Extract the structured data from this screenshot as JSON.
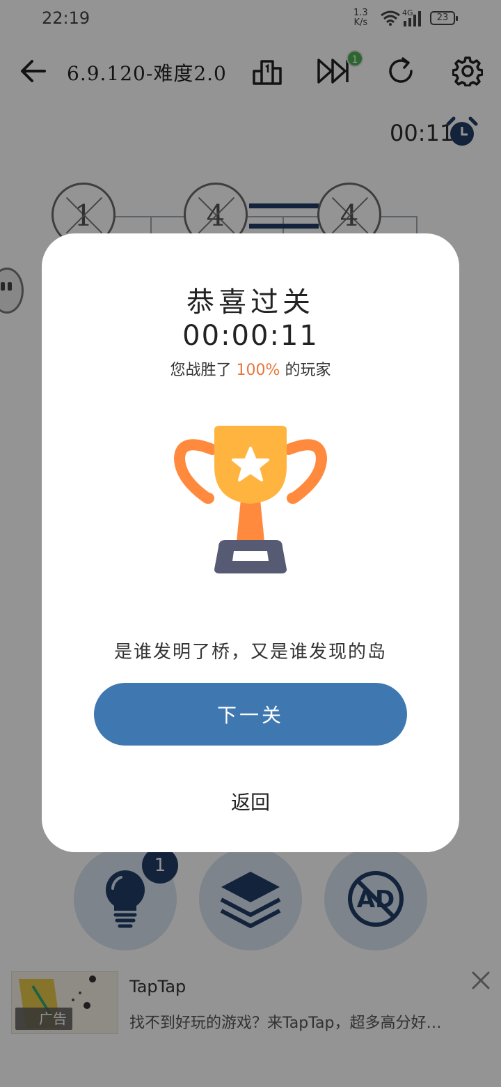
{
  "status_bar": {
    "time": "22:19",
    "net_speed_value": "1.3",
    "net_speed_unit": "K/s",
    "network_type": "4G",
    "battery": "23"
  },
  "app_bar": {
    "title": "6.9.120-难度2.0",
    "skip_badge": "1",
    "icons": [
      "back-arrow-icon",
      "leaderboard-icon",
      "fast-forward-icon",
      "restart-icon",
      "settings-icon"
    ]
  },
  "game": {
    "elapsed_timer": "00:11",
    "nodes": [
      "1",
      "4",
      "4"
    ],
    "hint_badge": "1",
    "tools": [
      "lightbulb-icon",
      "layers-icon",
      "no-ads-icon"
    ]
  },
  "dialog": {
    "title": "恭喜过关",
    "time": "00:00:11",
    "stat_prefix": "您战胜了",
    "stat_percent": "100%",
    "stat_suffix": "的玩家",
    "quote": "是谁发明了桥，又是谁发现的岛",
    "next_button": "下一关",
    "back_button": "返回"
  },
  "ad": {
    "tag": "广告",
    "title": "TapTap",
    "description": "找不到好玩的游戏？来TapTap，超多高分好…"
  },
  "colors": {
    "primary": "#3f78b0",
    "navy": "#1f3d66",
    "accent_orange": "#e8773a",
    "trophy_gold": "#ffb43f",
    "trophy_orange": "#ff8a3d",
    "trophy_base": "#575a73",
    "badge_green": "#4caf50"
  }
}
